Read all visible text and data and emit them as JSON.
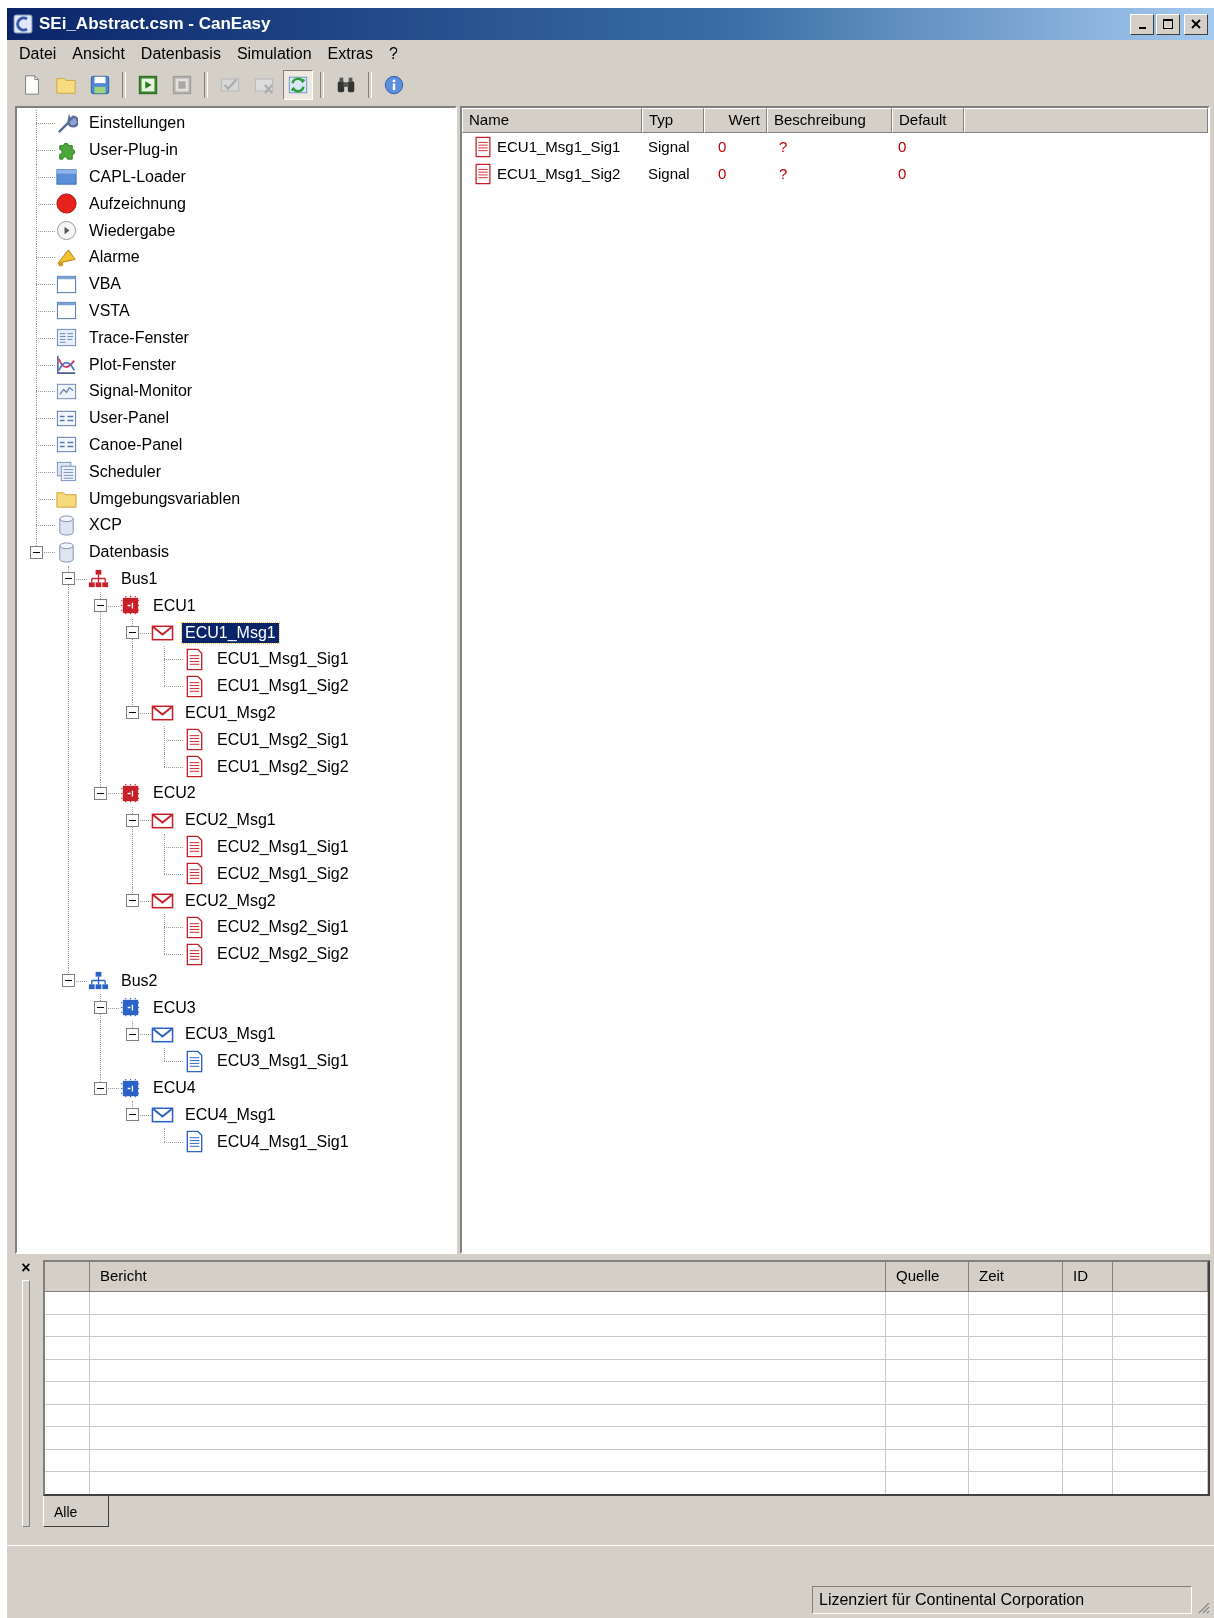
{
  "window": {
    "title": "SEi_Abstract.csm - CanEasy"
  },
  "menu": [
    {
      "label": "Datei"
    },
    {
      "label": "Ansicht"
    },
    {
      "label": "Datenbasis"
    },
    {
      "label": "Simulation"
    },
    {
      "label": "Extras"
    },
    {
      "label": "?"
    }
  ],
  "toolbar": {
    "groups": [
      [
        {
          "pressed": false,
          "disabled": false
        },
        {
          "pressed": false,
          "disabled": false
        },
        {
          "pressed": false,
          "disabled": false
        }
      ],
      [
        {
          "pressed": false,
          "disabled": false
        },
        {
          "pressed": false,
          "disabled": true
        }
      ],
      [
        {
          "pressed": false,
          "disabled": true
        },
        {
          "pressed": false,
          "disabled": true
        },
        {
          "pressed": true,
          "disabled": false
        }
      ],
      [
        {
          "pressed": false,
          "disabled": false
        }
      ],
      [
        {
          "pressed": false,
          "disabled": false
        }
      ]
    ]
  },
  "tree": [
    {
      "label": "Einstellungen",
      "kind": "wrench",
      "selected": false
    },
    {
      "label": "User-Plug-in",
      "kind": "puzzle",
      "selected": false
    },
    {
      "label": "CAPL-Loader",
      "kind": "loader",
      "selected": false
    },
    {
      "label": "Aufzeichnung",
      "kind": "record",
      "selected": false
    },
    {
      "label": "Wiedergabe",
      "kind": "playback",
      "selected": false
    },
    {
      "label": "Alarme",
      "kind": "bell",
      "selected": false
    },
    {
      "label": "VBA",
      "kind": "window",
      "selected": false
    },
    {
      "label": "VSTA",
      "kind": "window",
      "selected": false
    },
    {
      "label": "Trace-Fenster",
      "kind": "trace",
      "selected": false
    },
    {
      "label": "Plot-Fenster",
      "kind": "plot",
      "selected": false
    },
    {
      "label": "Signal-Monitor",
      "kind": "monitor",
      "selected": false
    },
    {
      "label": "User-Panel",
      "kind": "panel",
      "selected": false
    },
    {
      "label": "Canoe-Panel",
      "kind": "panel",
      "selected": false
    },
    {
      "label": "Scheduler",
      "kind": "scheduler",
      "selected": false
    },
    {
      "label": "Umgebungsvariablen",
      "kind": "folder",
      "selected": false
    },
    {
      "label": "XCP",
      "kind": "database",
      "selected": false
    },
    {
      "label": "Datenbasis",
      "kind": "database",
      "selected": false,
      "expanded": true,
      "children": [
        {
          "label": "Bus1",
          "kind": "bus",
          "color": "#c8202a",
          "selected": false,
          "expanded": true,
          "children": [
            {
              "label": "ECU1",
              "kind": "ecu",
              "color": "#c8202a",
              "selected": false,
              "expanded": true,
              "children": [
                {
                  "label": "ECU1_Msg1",
                  "kind": "message",
                  "color": "#c8202a",
                  "selected": true,
                  "expanded": true,
                  "children": [
                    {
                      "label": "ECU1_Msg1_Sig1",
                      "kind": "signal",
                      "color": "#c8202a",
                      "selected": false
                    },
                    {
                      "label": "ECU1_Msg1_Sig2",
                      "kind": "signal",
                      "color": "#c8202a",
                      "selected": false
                    }
                  ]
                },
                {
                  "label": "ECU1_Msg2",
                  "kind": "message",
                  "color": "#c8202a",
                  "selected": false,
                  "expanded": true,
                  "children": [
                    {
                      "label": "ECU1_Msg2_Sig1",
                      "kind": "signal",
                      "color": "#c8202a",
                      "selected": false
                    },
                    {
                      "label": "ECU1_Msg2_Sig2",
                      "kind": "signal",
                      "color": "#c8202a",
                      "selected": false
                    }
                  ]
                }
              ]
            },
            {
              "label": "ECU2",
              "kind": "ecu",
              "color": "#c8202a",
              "selected": false,
              "expanded": true,
              "children": [
                {
                  "label": "ECU2_Msg1",
                  "kind": "message",
                  "color": "#c8202a",
                  "selected": false,
                  "expanded": true,
                  "children": [
                    {
                      "label": "ECU2_Msg1_Sig1",
                      "kind": "signal",
                      "color": "#c8202a",
                      "selected": false
                    },
                    {
                      "label": "ECU2_Msg1_Sig2",
                      "kind": "signal",
                      "color": "#c8202a",
                      "selected": false
                    }
                  ]
                },
                {
                  "label": "ECU2_Msg2",
                  "kind": "message",
                  "color": "#c8202a",
                  "selected": false,
                  "expanded": true,
                  "children": [
                    {
                      "label": "ECU2_Msg2_Sig1",
                      "kind": "signal",
                      "color": "#c8202a",
                      "selected": false
                    },
                    {
                      "label": "ECU2_Msg2_Sig2",
                      "kind": "signal",
                      "color": "#c8202a",
                      "selected": false
                    }
                  ]
                }
              ]
            }
          ]
        },
        {
          "label": "Bus2",
          "kind": "bus",
          "color": "#2a62c8",
          "selected": false,
          "expanded": true,
          "children": [
            {
              "label": "ECU3",
              "kind": "ecu",
              "color": "#2a62c8",
              "selected": false,
              "expanded": true,
              "children": [
                {
                  "label": "ECU3_Msg1",
                  "kind": "message",
                  "color": "#2a62c8",
                  "selected": false,
                  "expanded": true,
                  "children": [
                    {
                      "label": "ECU3_Msg1_Sig1",
                      "kind": "signal",
                      "color": "#2a62c8",
                      "selected": false
                    }
                  ]
                }
              ]
            },
            {
              "label": "ECU4",
              "kind": "ecu",
              "color": "#2a62c8",
              "selected": false,
              "expanded": true,
              "children": [
                {
                  "label": "ECU4_Msg1",
                  "kind": "message",
                  "color": "#2a62c8",
                  "selected": false,
                  "expanded": true,
                  "children": [
                    {
                      "label": "ECU4_Msg1_Sig1",
                      "kind": "signal",
                      "color": "#2a62c8",
                      "selected": false
                    }
                  ]
                }
              ]
            }
          ]
        }
      ]
    }
  ],
  "signals": {
    "columns": [
      "Name",
      "Typ",
      "Wert",
      "Beschreibung",
      "Default"
    ],
    "rows": [
      {
        "name": "ECU1_Msg1_Sig1",
        "type": "Signal",
        "value": "0",
        "description": "?",
        "default": "0"
      },
      {
        "name": "ECU1_Msg1_Sig2",
        "type": "Signal",
        "value": "0",
        "description": "?",
        "default": "0"
      }
    ]
  },
  "log": {
    "close": "×",
    "columns": [
      "Bericht",
      "Quelle",
      "Zeit",
      "ID"
    ],
    "tabs": [
      {
        "label": "Alle",
        "selected": true
      }
    ]
  },
  "status_bar": {
    "text": "Lizenziert für Continental Corporation"
  }
}
